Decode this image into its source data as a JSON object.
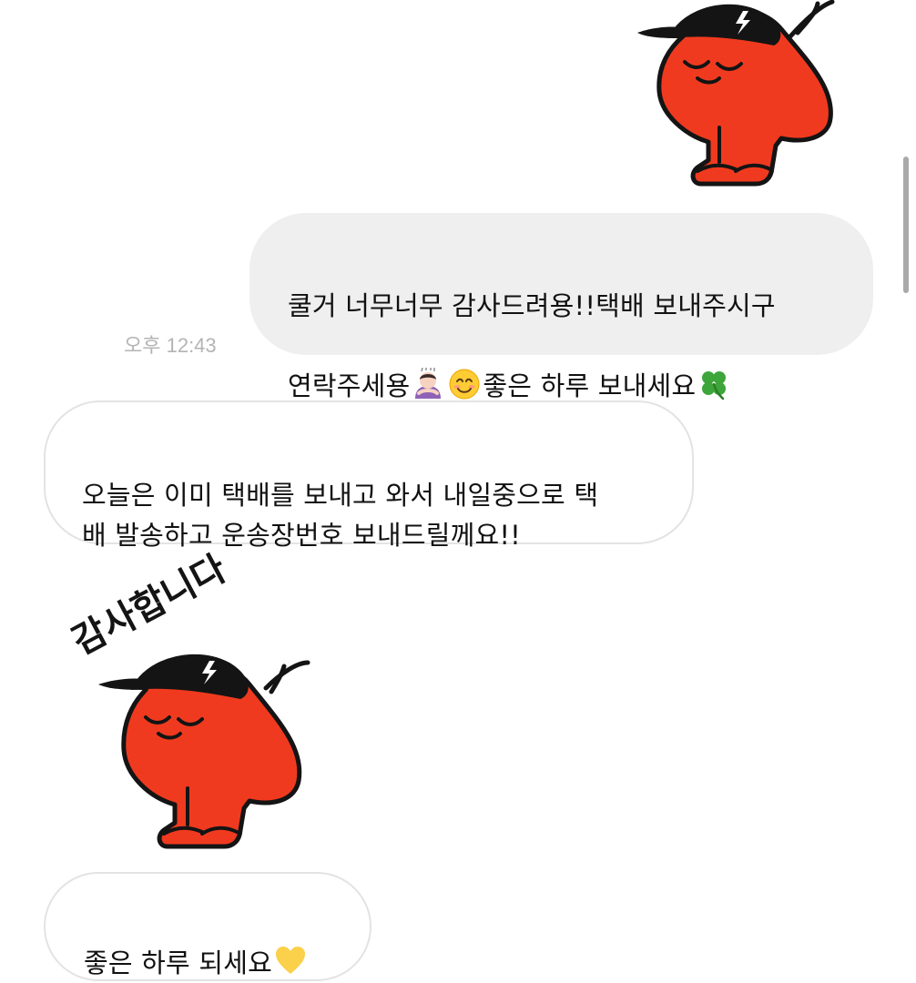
{
  "conversation": {
    "messages": [
      {
        "direction": "outgoing",
        "type": "sticker",
        "sticker": "bowing-red-blob-with-black-cap"
      },
      {
        "direction": "outgoing",
        "type": "text",
        "line1": "쿨거 너무너무 감사드려용!!택배 보내주시구",
        "line2_a": "연락주세용",
        "line2_b": "좋은 하루 보내세요",
        "emojis": [
          "person-bowing-emoji",
          "smiling-face-emoji",
          "four-leaf-clover-emoji"
        ],
        "time": "오후 12:43"
      },
      {
        "direction": "incoming",
        "type": "text",
        "text": "오늘은 이미 택배를 보내고 와서 내일중으로 택\n배 발송하고 운송장번호 보내드릴께요!!"
      },
      {
        "direction": "incoming",
        "type": "sticker",
        "sticker": "bowing-red-blob-with-black-cap",
        "caption": "감사합니다"
      },
      {
        "direction": "incoming",
        "type": "text",
        "text": "좋은 하루 되세요",
        "emojis": [
          "yellow-heart-emoji"
        ]
      }
    ]
  },
  "colors": {
    "sticker_red": "#f03a1f",
    "sticker_cap": "#141414",
    "outgoing_bubble": "#efefef",
    "incoming_border": "#e3e3e3",
    "timestamp": "#b4b4b4"
  }
}
